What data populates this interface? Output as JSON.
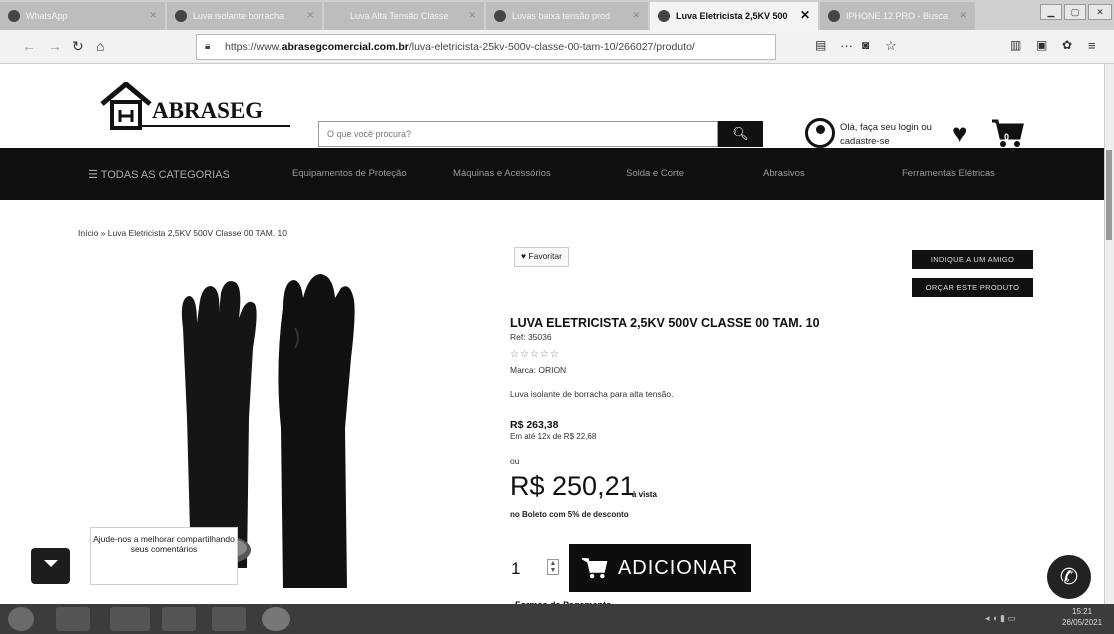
{
  "browser": {
    "tabs": [
      {
        "label": "WhatsApp"
      },
      {
        "label": "Luva isolante borracha"
      },
      {
        "label": "Luva Alta Tensão Classe"
      },
      {
        "label": "Luvas baixa tensão prod"
      },
      {
        "label": "Luva Eletricista 2,5KV 500"
      },
      {
        "label": "IPHONE 12 PRO - Busca"
      }
    ],
    "url_prefix": "https://www.",
    "url_domain": "abrasegcomercial.com.br",
    "url_path": "/luva-eletricista-25kv-500v-classe-00-tam-10/266027/produto/",
    "more": "···"
  },
  "site": {
    "logo_text": "ABRASEG",
    "search_placeholder": "O que você procura?",
    "login_text": "Olá, faça seu login ou cadastre-se",
    "cart_count": "0"
  },
  "categories": [
    "☰ TODAS AS CATEGORIAS",
    "Equipamentos de Proteção",
    "Máquinas e Acessórios",
    "Solda e Corte",
    "Abrasivos",
    "Ferramentas Elétricas"
  ],
  "product": {
    "breadcrumb": "Início » Luva Eletricista 2,5KV 500V Classe 00 TAM. 10",
    "favorite": "♥ Favoritar",
    "indique": "INDIQUE A UM AMIGO",
    "orcar": "ORÇAR ESTE PRODUTO",
    "title": "LUVA ELETRICISTA 2,5KV 500V CLASSE 00 TAM. 10",
    "ref": "Ref: 35036",
    "rating": 0,
    "brand": "Marca: ORION",
    "description": "Luva isolante de borracha para alta tensão.",
    "old_price": "R$ 263,38",
    "installments": "Em até 12x de R$ 22,68",
    "or": "ou",
    "price": "R$ 250,21",
    "price_suffix": "à vista",
    "boleto": "no Boleto com 5% de desconto",
    "quantity": "1",
    "add_label": "ADICIONAR",
    "payment_heading": "Formas de Pagamento"
  },
  "feedback": {
    "text": "Ajude-nos a melhorar compartilhando seus comentários"
  },
  "taskbar": {
    "time": "15:21",
    "date": "26/05/2021"
  }
}
